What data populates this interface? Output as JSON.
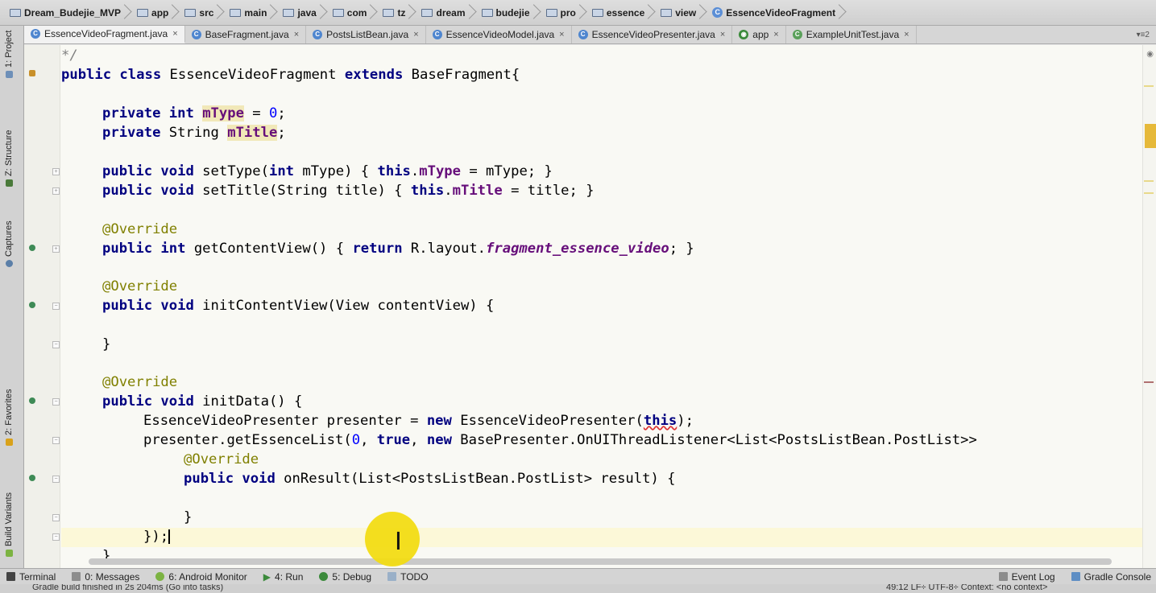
{
  "breadcrumb": [
    {
      "label": "Dream_Budejie_MVP",
      "icon": "project-folder-icon"
    },
    {
      "label": "app",
      "icon": "module-folder-icon"
    },
    {
      "label": "src",
      "icon": "folder-icon"
    },
    {
      "label": "main",
      "icon": "folder-icon"
    },
    {
      "label": "java",
      "icon": "folder-icon"
    },
    {
      "label": "com",
      "icon": "package-icon"
    },
    {
      "label": "tz",
      "icon": "package-icon"
    },
    {
      "label": "dream",
      "icon": "package-icon"
    },
    {
      "label": "budejie",
      "icon": "package-icon"
    },
    {
      "label": "pro",
      "icon": "package-icon"
    },
    {
      "label": "essence",
      "icon": "package-icon"
    },
    {
      "label": "view",
      "icon": "package-icon"
    },
    {
      "label": "EssenceVideoFragment",
      "icon": "class-icon"
    }
  ],
  "tabs": [
    {
      "label": "EssenceVideoFragment.java",
      "active": true,
      "close": "×"
    },
    {
      "label": "BaseFragment.java",
      "active": false,
      "close": "×"
    },
    {
      "label": "PostsListBean.java",
      "active": false,
      "close": "×"
    },
    {
      "label": "EssenceVideoModel.java",
      "active": false,
      "close": "×"
    },
    {
      "label": "EssenceVideoPresenter.java",
      "active": false,
      "close": "×"
    },
    {
      "label": "app",
      "active": false,
      "close": "×"
    },
    {
      "label": "ExampleUnitTest.java",
      "active": false,
      "close": "×"
    }
  ],
  "tab_overflow": "▾≡2",
  "left_tools": [
    {
      "label": "1: Project"
    },
    {
      "label": "Z: Structure"
    },
    {
      "label": "Captures"
    },
    {
      "label": "2: Favorites"
    },
    {
      "label": "Build Variants"
    }
  ],
  "bottom_tools": [
    {
      "label": "Terminal"
    },
    {
      "label": "0: Messages"
    },
    {
      "label": "6: Android Monitor"
    },
    {
      "label": "4: Run"
    },
    {
      "label": "5: Debug"
    },
    {
      "label": "TODO"
    }
  ],
  "bottom_right_tools": [
    {
      "label": "Event Log"
    },
    {
      "label": "Gradle Console"
    }
  ],
  "status": {
    "message": "Gradle build finished in 2s 204ms (Go into tasks)",
    "position": "49:12  LF÷  UTF-8÷  Context: <no context>"
  },
  "code_lines": {
    "l1": "*/",
    "l2_kw": "public class",
    "l2_name": "EssenceVideoFragment",
    "l2_ext": "extends",
    "l2_base": "BaseFragment{",
    "l3_kw": "private int",
    "l3_field": "mType",
    "l3_eq": " = ",
    "l3_num": "0",
    "l3_end": ";",
    "l4_kw": "private",
    "l4_type": " String ",
    "l4_field": "mTitle",
    "l4_end": ";",
    "l5_kw": "public void",
    "l5_sig": " setType(",
    "l5_kw2": "int",
    "l5_p": " mType) { ",
    "l5_this": "this",
    "l5_dot": ".",
    "l5_field": "mType",
    "l5_rest": " = mType; }",
    "l6_kw": "public void",
    "l6_sig": " setTitle(String title) { ",
    "l6_this": "this",
    "l6_dot": ".",
    "l6_field": "mTitle",
    "l6_rest": " = title; }",
    "l7_ann": "@Override",
    "l8_kw": "public int",
    "l8_sig": " getContentView() { ",
    "l8_ret": "return",
    "l8_r": " R.layout.",
    "l8_field": "fragment_essence_video",
    "l8_end": "; }",
    "l9_ann": "@Override",
    "l10_kw": "public void",
    "l10_sig": " initContentView(View contentView) {",
    "l11": "}",
    "l12_ann": "@Override",
    "l13_kw": "public void",
    "l13_sig": " initData() {",
    "l14_a": "EssenceVideoPresenter presenter = ",
    "l14_new": "new",
    "l14_b": " EssenceVideoPresenter(",
    "l14_this": "this",
    "l14_c": ");",
    "l15_a": "presenter.getEssenceList(",
    "l15_num": "0",
    "l15_b": ", ",
    "l15_true": "true",
    "l15_c": ", ",
    "l15_new": "new",
    "l15_d": " BasePresenter.OnUIThreadListener<List<PostsListBean.PostList>>",
    "l16_ann": "@Override",
    "l17_kw": "public void",
    "l17_sig": " onResult(List<PostsListBean.PostList> result) {",
    "l18": "}",
    "l19": "});",
    "l20": "}"
  },
  "colors": {
    "keyword": "#000080",
    "annotation": "#808000",
    "field": "#660e7a",
    "number": "#0000ff",
    "cursor_highlight": "#f2dc14"
  }
}
